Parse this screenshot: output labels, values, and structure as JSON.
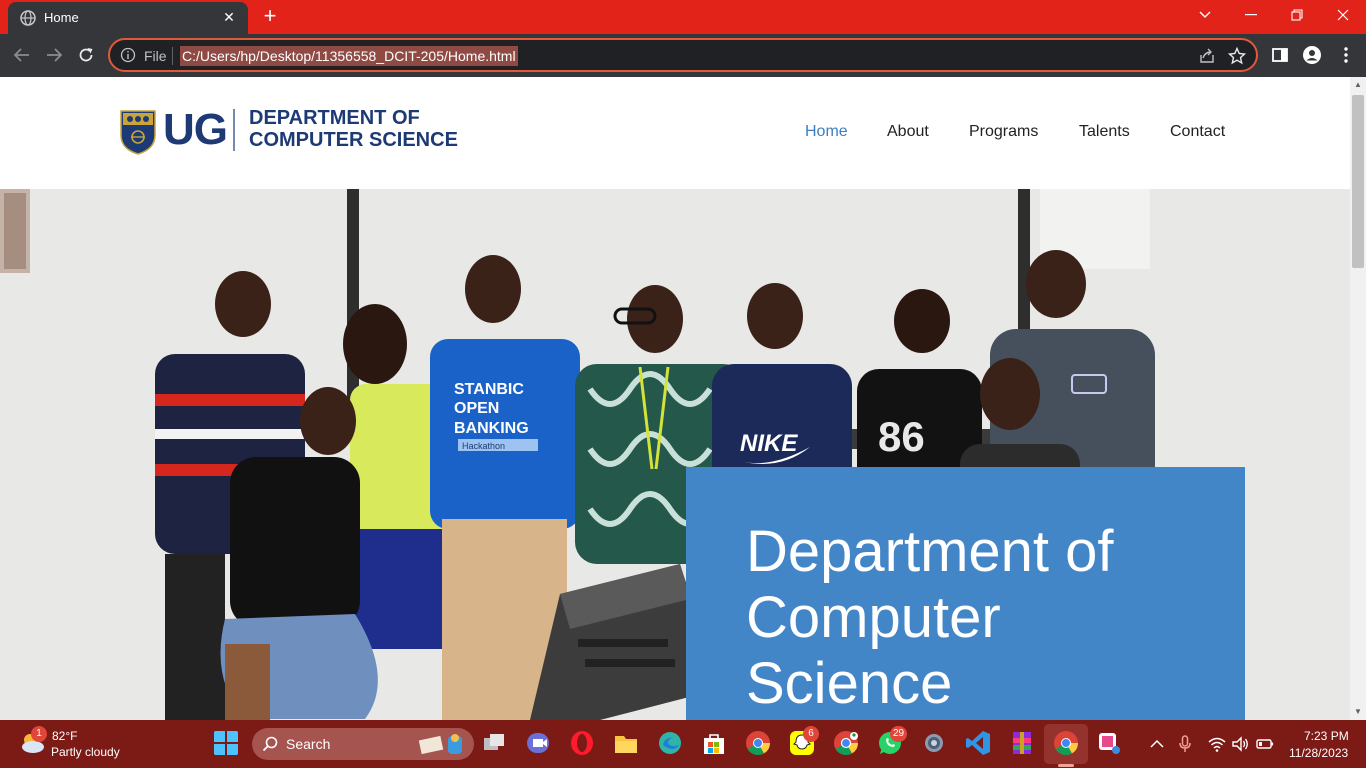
{
  "browser": {
    "tab_title": "Home",
    "omnibox": {
      "scheme_label": "File",
      "url": "C:/Users/hp/Desktop/11356558_DCIT-205/Home.html"
    },
    "icons": [
      "globe-icon",
      "close-icon",
      "plus-icon",
      "chevron-down-icon",
      "minimize-icon",
      "restore-icon",
      "close-icon",
      "back-icon",
      "forward-icon",
      "reload-icon",
      "info-icon",
      "share-icon",
      "star-icon",
      "side-panel-icon",
      "profile-icon",
      "kebab-menu-icon"
    ]
  },
  "site": {
    "logo": {
      "mark": "UG",
      "line1": "DEPARTMENT OF",
      "line2": "COMPUTER SCIENCE"
    },
    "nav": [
      {
        "label": "Home",
        "active": true
      },
      {
        "label": "About",
        "active": false
      },
      {
        "label": "Programs",
        "active": false
      },
      {
        "label": "Talents",
        "active": false
      },
      {
        "label": "Contact",
        "active": false
      }
    ],
    "hero": {
      "title": "Department of Computer Science",
      "shirt_text": {
        "line1": "STANBIC",
        "line2": "OPEN",
        "line3": "BANKING",
        "line4": "Hackathon",
        "brand": "NIKE",
        "number": "86"
      }
    },
    "colors": {
      "nav_active": "#3c7fc0",
      "hero_box": "#4386c8",
      "logo_navy": "#1d3a74"
    }
  },
  "taskbar": {
    "weather": {
      "badge": "1",
      "temp": "82°F",
      "desc": "Partly cloudy"
    },
    "search_label": "Search",
    "badges": {
      "snapchat": "6",
      "whatsapp": "29"
    },
    "clock": {
      "time": "7:23 PM",
      "date": "11/28/2023"
    },
    "colors": {
      "background": "#7c1a16"
    }
  }
}
